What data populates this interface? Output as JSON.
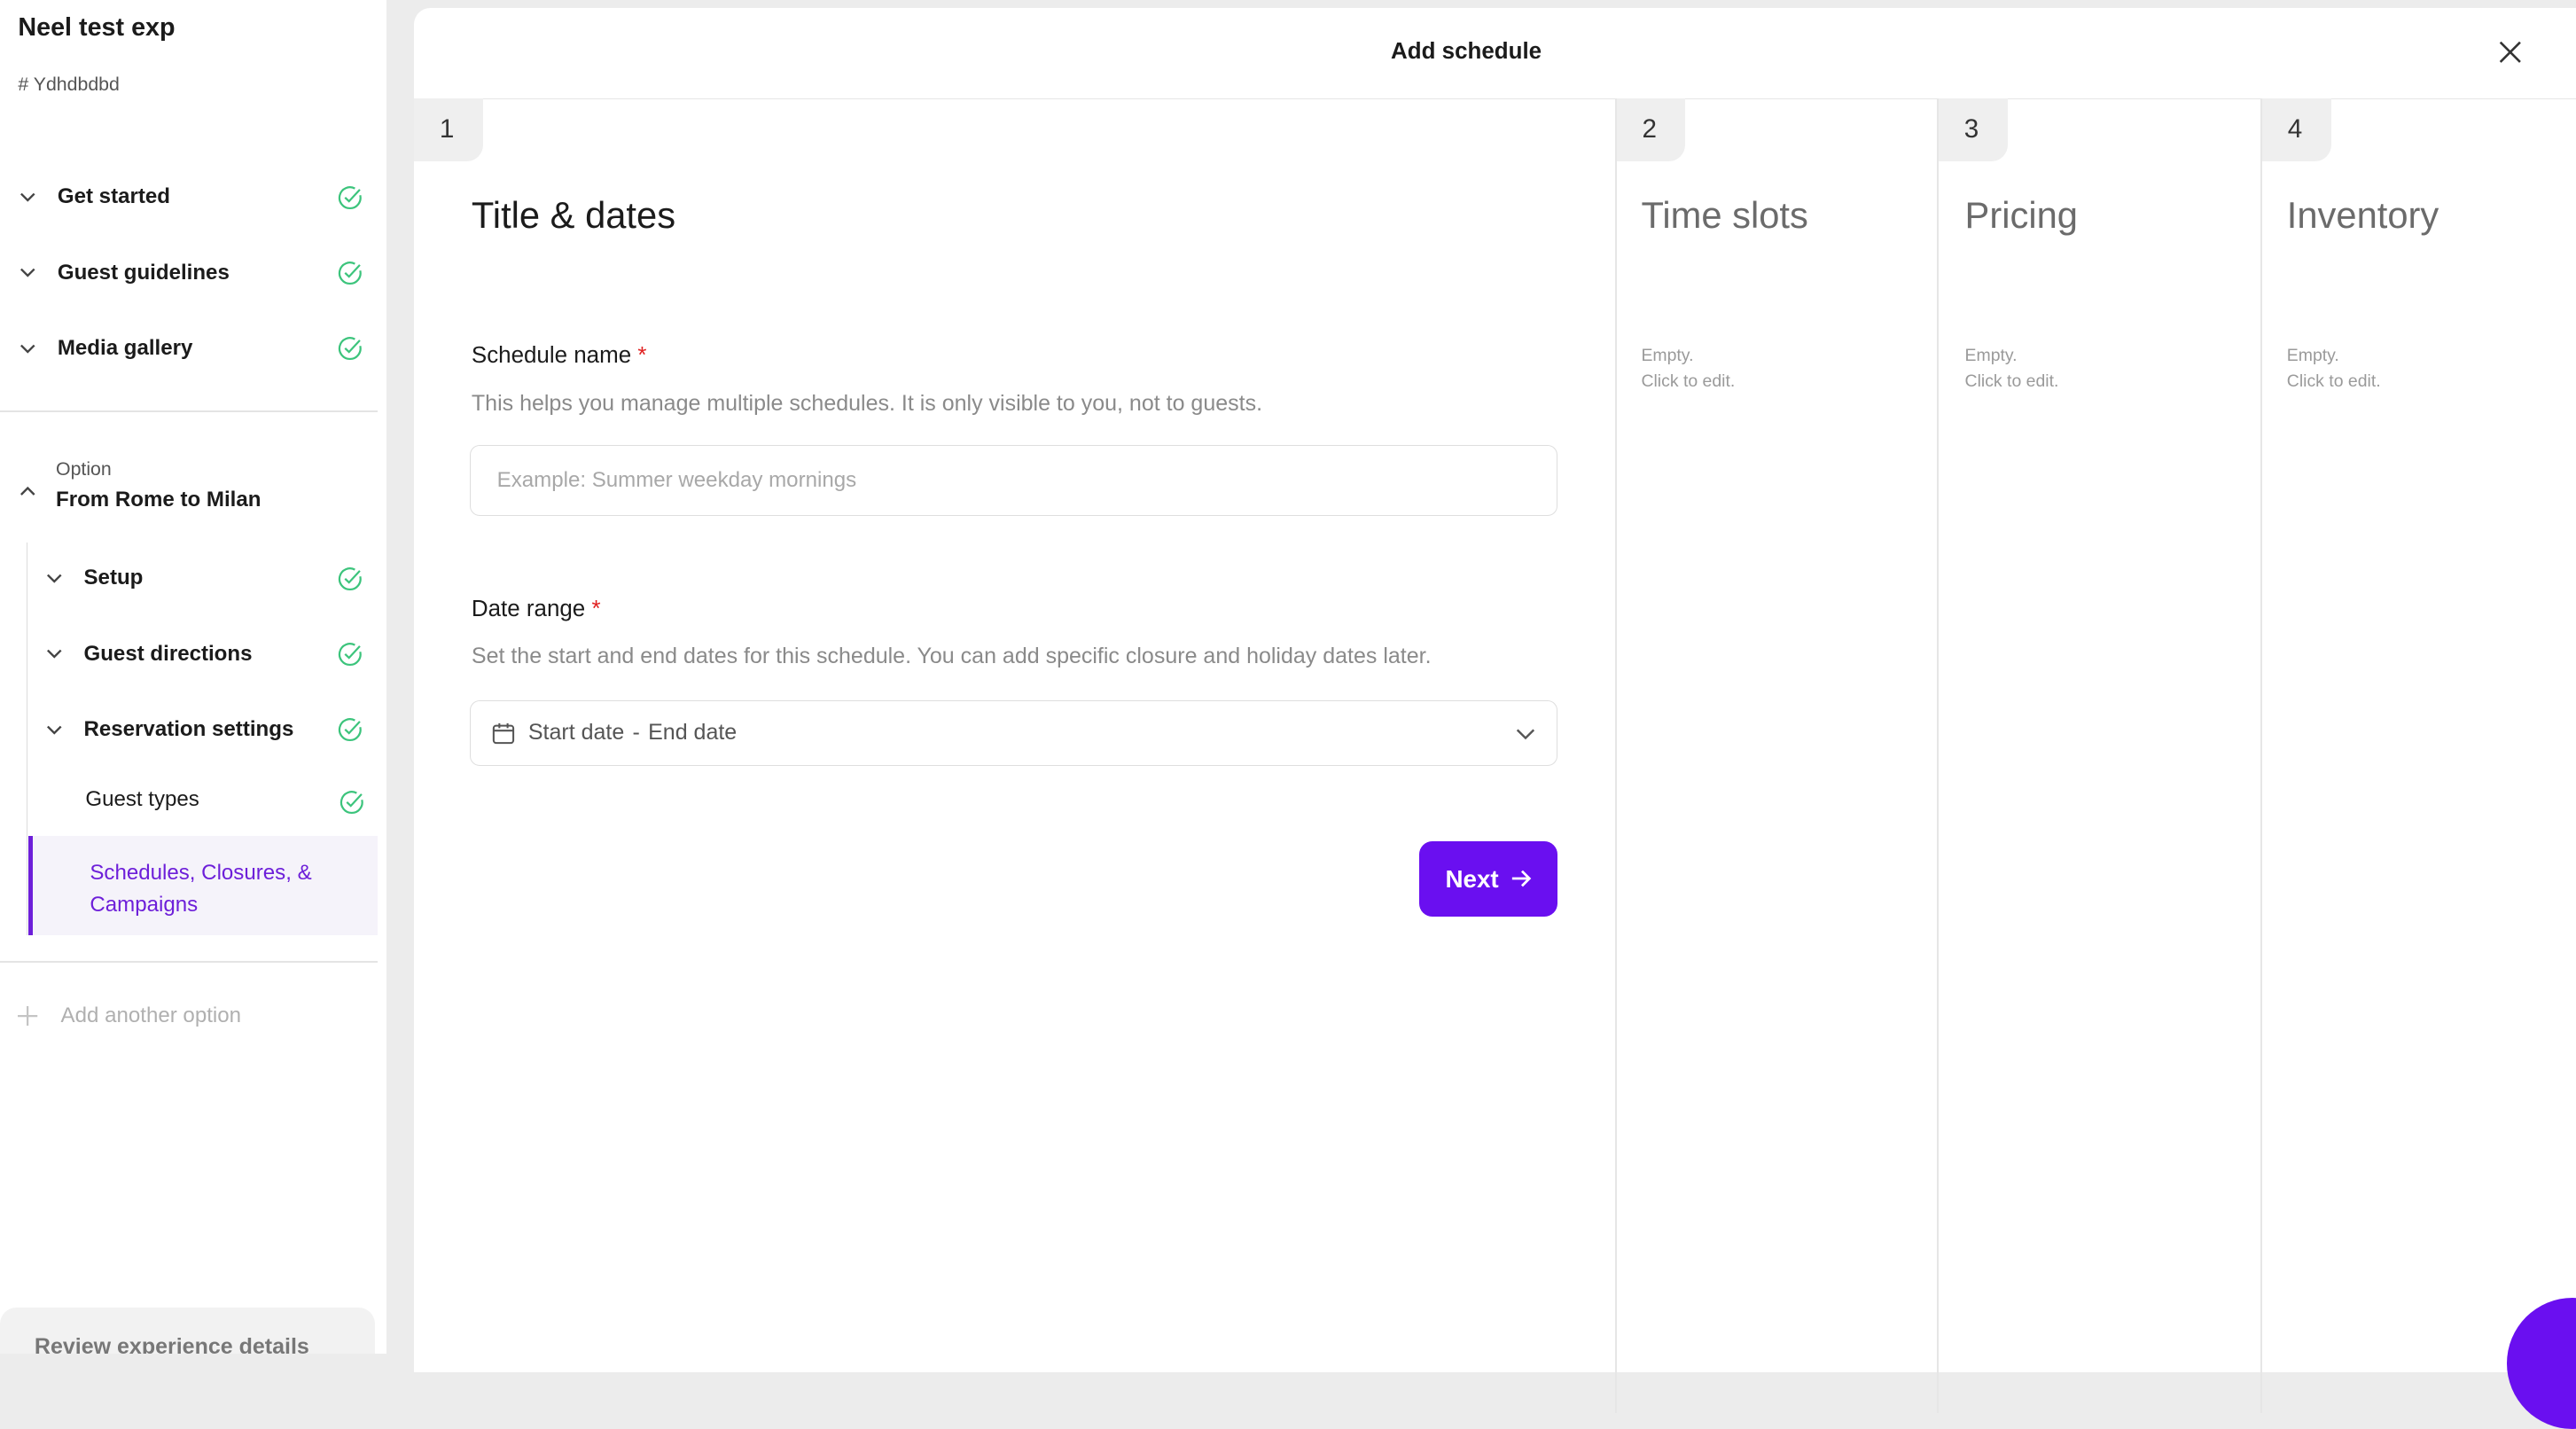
{
  "sidebar": {
    "experience_title": "Neel test exp",
    "experience_id": "# Ydhdbdbd",
    "sections": [
      {
        "label": "Get started"
      },
      {
        "label": "Guest guidelines"
      },
      {
        "label": "Media gallery"
      }
    ],
    "option": {
      "small_label": "Option",
      "title": "From Rome to Milan",
      "items": [
        {
          "label": "Setup"
        },
        {
          "label": "Guest directions"
        },
        {
          "label": "Reservation settings"
        }
      ],
      "sub_items": [
        {
          "label": "Guest types"
        },
        {
          "label": "Schedules, Closures, & Campaigns"
        }
      ]
    },
    "add_option": "Add another option",
    "review_button": "Review experience details"
  },
  "modal": {
    "title": "Add schedule",
    "steps": [
      {
        "number": "1",
        "title": "Title & dates"
      },
      {
        "number": "2",
        "title": "Time slots",
        "empty_line1": "Empty.",
        "empty_line2": "Click to edit."
      },
      {
        "number": "3",
        "title": "Pricing",
        "empty_line1": "Empty.",
        "empty_line2": "Click to edit."
      },
      {
        "number": "4",
        "title": "Inventory",
        "empty_line1": "Empty.",
        "empty_line2": "Click to edit."
      }
    ],
    "schedule_name": {
      "label": "Schedule name",
      "required_mark": "*",
      "help": "This helps you manage multiple schedules. It is only visible to you, not to guests.",
      "placeholder": "Example: Summer weekday mornings",
      "value": ""
    },
    "date_range": {
      "label": "Date range",
      "required_mark": "*",
      "help": "Set the start and end dates for this schedule. You can add specific closure and holiday dates later.",
      "start_placeholder": "Start date",
      "separator": "-",
      "end_placeholder": "End date"
    },
    "next_label": "Next"
  },
  "colors": {
    "accent": "#6a0ff0",
    "check": "#3cc47c",
    "required": "#e02020"
  }
}
